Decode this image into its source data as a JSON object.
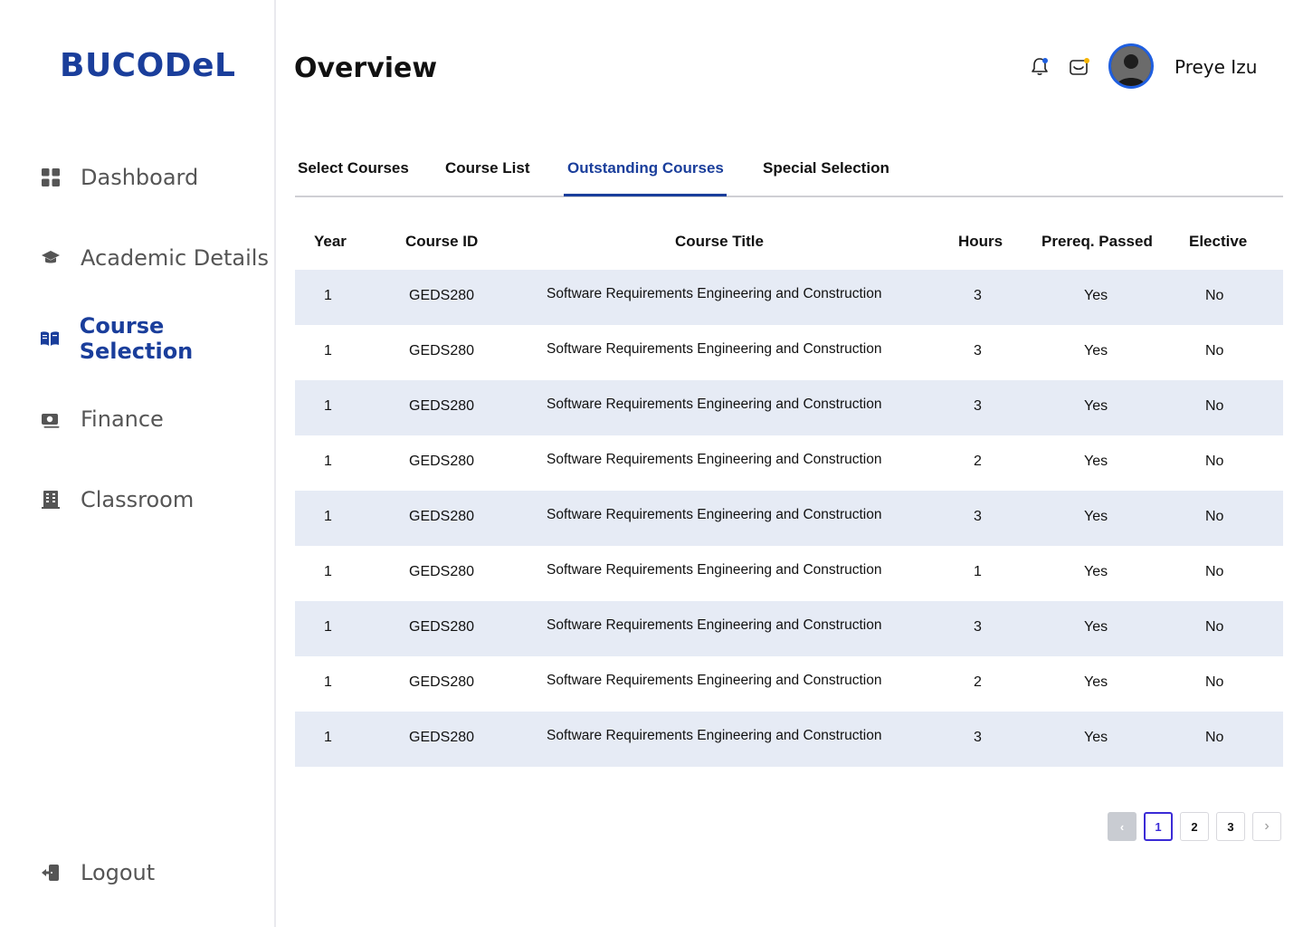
{
  "app": {
    "logo": "BUCODeL"
  },
  "sidebar": {
    "items": [
      {
        "label": "Dashboard",
        "icon": "dashboard-grid-icon"
      },
      {
        "label": "Academic Details",
        "icon": "graduation-cap-icon"
      },
      {
        "label": "Course Selection",
        "icon": "book-open-icon",
        "active": true
      },
      {
        "label": "Finance",
        "icon": "money-icon"
      },
      {
        "label": "Classroom",
        "icon": "building-icon"
      }
    ],
    "logout": {
      "label": "Logout",
      "icon": "logout-icon"
    }
  },
  "header": {
    "title": "Overview",
    "user_name": "Preye Izu",
    "icons": [
      "bell-icon",
      "mail-icon"
    ]
  },
  "tabs": [
    {
      "label": "Select Courses"
    },
    {
      "label": "Course List"
    },
    {
      "label": "Outstanding Courses",
      "active": true
    },
    {
      "label": "Special Selection"
    }
  ],
  "table": {
    "columns": [
      "Year",
      "Course ID",
      "Course Title",
      "Hours",
      "Prereq. Passed",
      "Elective"
    ],
    "rows": [
      [
        "1",
        "GEDS280",
        "Software Requirements Engineering and Construction",
        "3",
        "Yes",
        "No"
      ],
      [
        "1",
        "GEDS280",
        "Software Requirements Engineering and Construction",
        "3",
        "Yes",
        "No"
      ],
      [
        "1",
        "GEDS280",
        "Software Requirements Engineering and Construction",
        "3",
        "Yes",
        "No"
      ],
      [
        "1",
        "GEDS280",
        "Software Requirements Engineering and Construction",
        "2",
        "Yes",
        "No"
      ],
      [
        "1",
        "GEDS280",
        "Software Requirements Engineering and Construction",
        "3",
        "Yes",
        "No"
      ],
      [
        "1",
        "GEDS280",
        "Software Requirements Engineering and Construction",
        "1",
        "Yes",
        "No"
      ],
      [
        "1",
        "GEDS280",
        "Software Requirements Engineering and Construction",
        "3",
        "Yes",
        "No"
      ],
      [
        "1",
        "GEDS280",
        "Software Requirements Engineering and Construction",
        "2",
        "Yes",
        "No"
      ],
      [
        "1",
        "GEDS280",
        "Software Requirements Engineering and Construction",
        "3",
        "Yes",
        "No"
      ]
    ]
  },
  "pagination": {
    "prev": "‹",
    "next": "›",
    "pages": [
      "1",
      "2",
      "3"
    ],
    "current": "1"
  },
  "colors": {
    "brand": "#1a3e9b",
    "row_shade": "#e6ebf5",
    "notification_dot": "#1f5fe0",
    "mail_dot": "#f5b400",
    "pager_current": "#3b2bd6"
  }
}
